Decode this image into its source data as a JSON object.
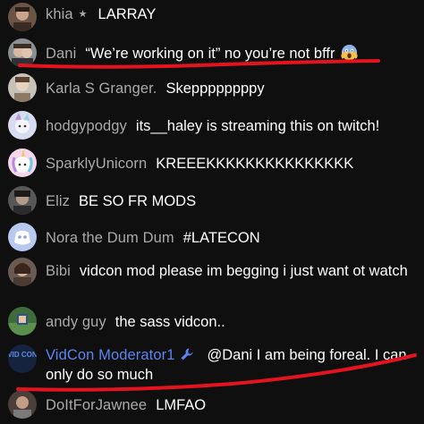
{
  "messages": [
    {
      "author": "khia",
      "badge": "star",
      "text": "LARRAY"
    },
    {
      "author": "Dani",
      "text": "“We’re working on it” no you’re not bffr",
      "emoji": "face-screaming-in-fear"
    },
    {
      "author": "Karla S Granger.",
      "text": "Skeppppppppy"
    },
    {
      "author": "hodgypodgy",
      "text": "its__haley is streaming this on twitch!"
    },
    {
      "author": "SparklyUnicorn",
      "text": "KREEEKKKKKKKKKKKKKKK"
    },
    {
      "author": "Eliz",
      "text": "BE SO FR MODS"
    },
    {
      "author": "Nora the Dum Dum",
      "text": "#LATECON"
    },
    {
      "author": "Bibi",
      "text": "vidcon mod please im begging i just want ot watch"
    },
    {
      "author": "andy guy",
      "text": "the sass vidcon.."
    },
    {
      "author": "VidCon Moderator1",
      "badge": "wrench",
      "text": "@Dani I am being foreal. I can only do so much"
    },
    {
      "author": "DoItForJawnee",
      "text": "LMFAO"
    }
  ],
  "avatar_labels": {
    "vidcon_mod": "VID CON"
  },
  "colors": {
    "background": "#0f0f0f",
    "author": "#aaaaaa",
    "moderator": "#5e84f1",
    "text": "#ffffff",
    "annotation": "#e3141f"
  }
}
